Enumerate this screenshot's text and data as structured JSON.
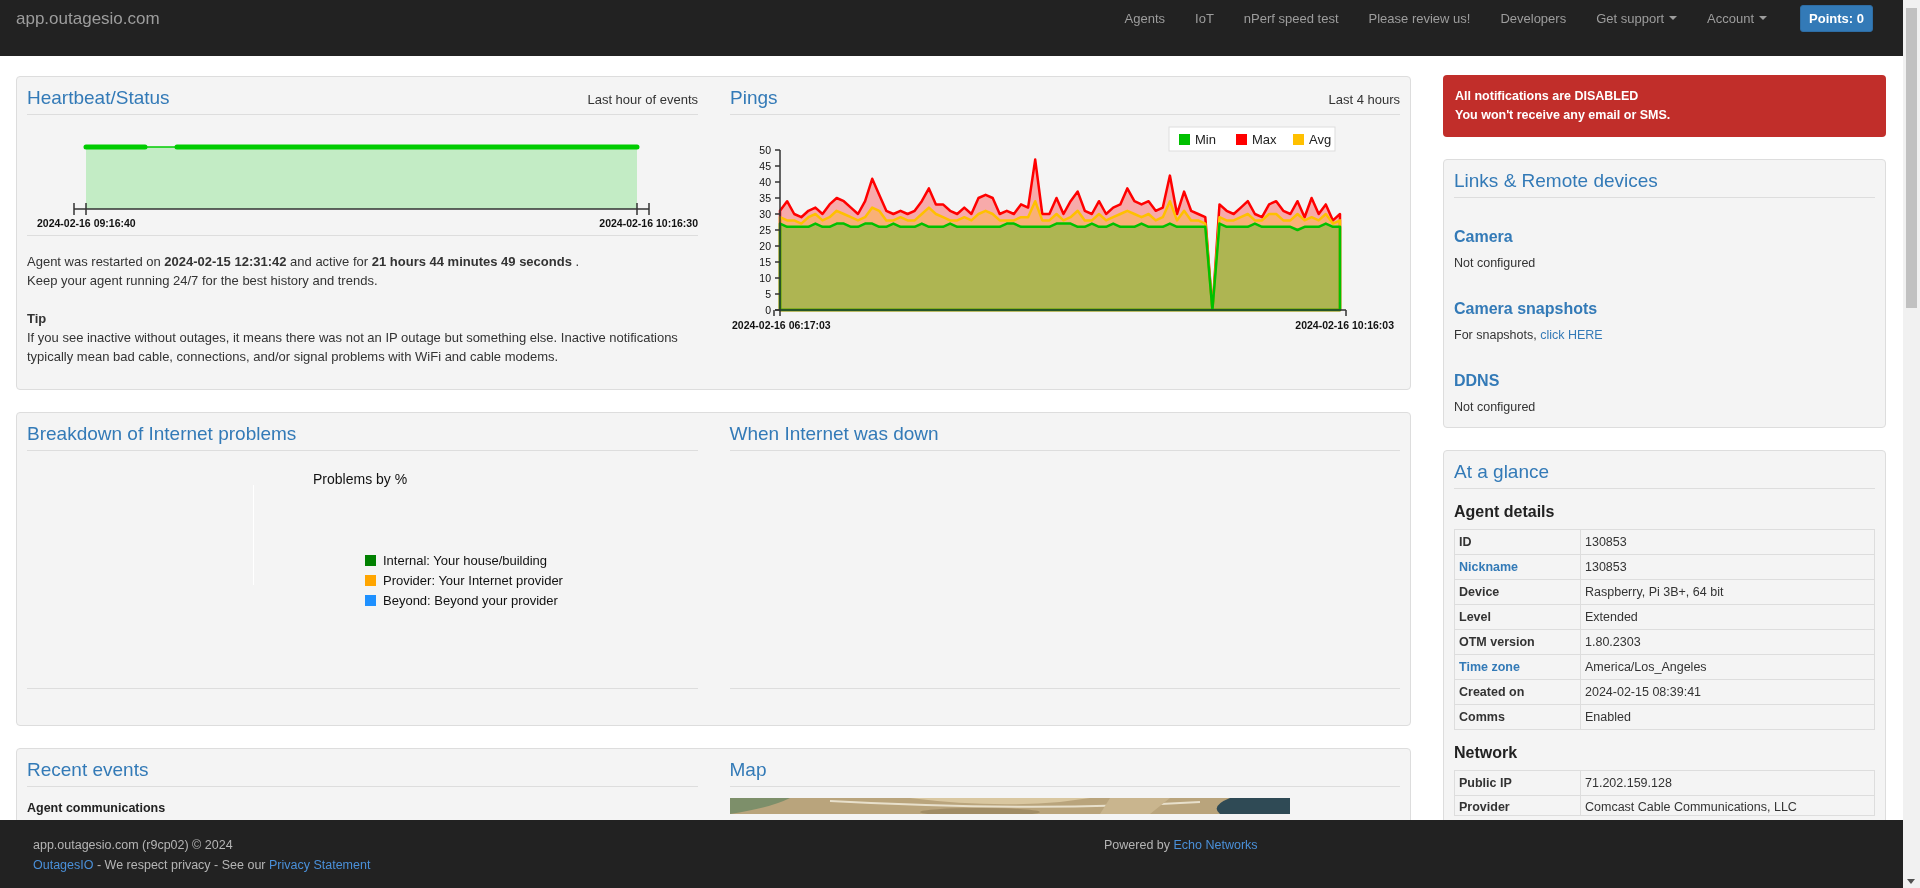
{
  "navbar": {
    "brand": "app.outagesio.com",
    "items": [
      {
        "label": "Agents",
        "dropdown": false
      },
      {
        "label": "IoT",
        "dropdown": false
      },
      {
        "label": "nPerf speed test",
        "dropdown": false
      },
      {
        "label": "Please review us!",
        "dropdown": false
      },
      {
        "label": "Developers",
        "dropdown": false
      },
      {
        "label": "Get support",
        "dropdown": true
      },
      {
        "label": "Account",
        "dropdown": true
      }
    ],
    "points_button": "Points: 0"
  },
  "heartbeat": {
    "title": "Heartbeat/Status",
    "range": "Last hour of events",
    "chart_start": "2024-02-16 09:16:40",
    "chart_end": "2024-02-16 10:16:30",
    "restart_text": "Agent was restarted on **2024-02-15 12:31:42** and active for **21 hours 44 minutes 49 seconds** .",
    "keep_running": "Keep your agent running 24/7 for the best history and trends.",
    "tip_title": "Tip",
    "tip_text": "If you see inactive without outages, it means there was not an IP outage but something else. Inactive notifications typically mean bad cable, connections, and/or signal problems with WiFi and cable modems."
  },
  "pings": {
    "title": "Pings",
    "range": "Last 4 hours",
    "start_label": "2024-02-16 06:17:03",
    "end_label": "2024-02-16 10:16:03",
    "chart_data": {
      "type": "area",
      "ylim": [
        0,
        50
      ],
      "yticks": [
        0,
        5,
        10,
        15,
        20,
        25,
        30,
        35,
        40,
        45,
        50
      ],
      "legend": "upper right",
      "series": [
        {
          "name": "Min",
          "color": "#00c000",
          "values": [
            27,
            26,
            26,
            26,
            26,
            27,
            26,
            26,
            27,
            27,
            26,
            26,
            27,
            27,
            26,
            26,
            27,
            26,
            26,
            26,
            27,
            26,
            26,
            26,
            27,
            26,
            26,
            26,
            26,
            26,
            26,
            26,
            27,
            27,
            26,
            26,
            26,
            26,
            26,
            27,
            27,
            27,
            26,
            26,
            27,
            26,
            26,
            27,
            26,
            26,
            26,
            27,
            26,
            26,
            26,
            27,
            26,
            26,
            26,
            26,
            26,
            0,
            27,
            26,
            26,
            26,
            26,
            27,
            26,
            26,
            26,
            26,
            26,
            25,
            26,
            26,
            26,
            27,
            26,
            26
          ]
        },
        {
          "name": "Max",
          "color": "#ff0000",
          "values": [
            31,
            34,
            30,
            29,
            31,
            32,
            30,
            33,
            35,
            34,
            32,
            30,
            34,
            41,
            36,
            31,
            30,
            31,
            30,
            31,
            34,
            38,
            33,
            33,
            31,
            30,
            32,
            30,
            35,
            36,
            35,
            30,
            31,
            30,
            33,
            32,
            47,
            30,
            30,
            35,
            30,
            34,
            37,
            31,
            30,
            34,
            30,
            32,
            33,
            38,
            34,
            33,
            34,
            31,
            32,
            42,
            30,
            37,
            31,
            30,
            29,
            0,
            33,
            31,
            30,
            32,
            34,
            30,
            29,
            33,
            34,
            31,
            30,
            34,
            29,
            35,
            30,
            33,
            28,
            30
          ]
        },
        {
          "name": "Avg",
          "color": "#ffc000",
          "values": [
            29,
            28,
            28,
            27,
            29,
            30,
            28,
            29,
            31,
            30,
            29,
            28,
            29,
            32,
            31,
            28,
            28,
            29,
            28,
            28,
            30,
            32,
            30,
            29,
            28,
            28,
            29,
            28,
            30,
            31,
            30,
            28,
            28,
            28,
            29,
            29,
            34,
            28,
            28,
            30,
            28,
            29,
            31,
            28,
            28,
            30,
            28,
            29,
            30,
            31,
            30,
            29,
            30,
            28,
            29,
            34,
            28,
            31,
            28,
            28,
            27,
            0,
            29,
            28,
            28,
            29,
            30,
            28,
            28,
            30,
            30,
            28,
            28,
            30,
            28,
            29,
            28,
            30,
            27,
            28
          ]
        }
      ]
    }
  },
  "breakdown": {
    "title": "Breakdown of Internet problems",
    "chart_title": "Problems by %",
    "legend": [
      {
        "label": "Internal: Your house/building",
        "color": "#008000"
      },
      {
        "label": "Provider: Your Internet provider",
        "color": "#ffa500"
      },
      {
        "label": "Beyond: Beyond your provider",
        "color": "#1e90ff"
      }
    ]
  },
  "downtime": {
    "title": "When Internet was down"
  },
  "recent_events": {
    "title": "Recent events",
    "subtitle": "Agent communications"
  },
  "map": {
    "title": "Map"
  },
  "alert": {
    "lines": [
      "All notifications are DISABLED",
      "You won't receive any email or SMS."
    ]
  },
  "links": {
    "title": "Links & Remote devices",
    "items": [
      {
        "name": "Camera",
        "text": "Not configured"
      },
      {
        "name": "Camera snapshots",
        "text": "For snapshots, ",
        "link": "click HERE"
      },
      {
        "name": "DDNS",
        "text": "Not configured"
      }
    ]
  },
  "glance": {
    "title": "At a glance",
    "sections": [
      {
        "title": "Agent details",
        "rows": [
          {
            "label": "ID",
            "value": "130853",
            "link": false
          },
          {
            "label": "Nickname",
            "value": "130853",
            "link": true
          },
          {
            "label": "Device",
            "value": "Raspberry, Pi 3B+, 64 bit",
            "link": false
          },
          {
            "label": "Level",
            "value": "Extended",
            "link": false
          },
          {
            "label": "OTM version",
            "value": "1.80.2303",
            "link": false
          },
          {
            "label": "Time zone",
            "value": "America/Los_Angeles",
            "link": true
          },
          {
            "label": "Created on",
            "value": "2024-02-15 08:39:41",
            "link": false
          },
          {
            "label": "Comms",
            "value": "Enabled",
            "link": false
          }
        ]
      },
      {
        "title": "Network",
        "rows": [
          {
            "label": "Public IP",
            "value": "71.202.159.128",
            "link": false
          },
          {
            "label": "Provider",
            "value": "Comcast Cable Communications, LLC",
            "link": false
          }
        ]
      }
    ]
  },
  "footer": {
    "copyright": "app.outagesio.com (r9cp02) © 2024",
    "brand_link": "OutagesIO",
    "privacy_text": " - We respect privacy - See our ",
    "privacy_link": "Privacy Statement",
    "powered_by": "Powered by ",
    "company_link": "Echo Networks"
  }
}
